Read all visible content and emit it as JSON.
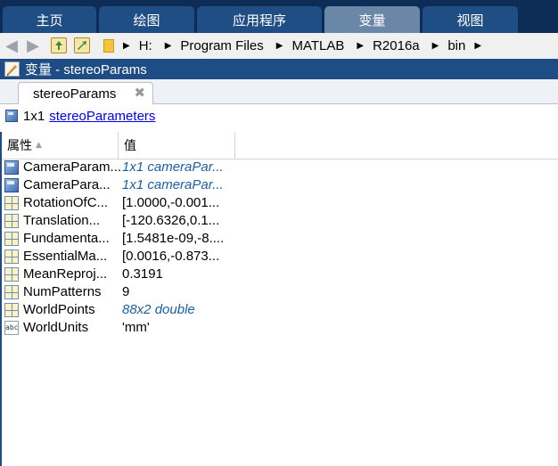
{
  "ribbon": {
    "tabs": [
      {
        "label": "主页",
        "active": false
      },
      {
        "label": "绘图",
        "active": false
      },
      {
        "label": "应用程序",
        "active": false
      },
      {
        "label": "变量",
        "active": true
      },
      {
        "label": "视图",
        "active": false
      }
    ]
  },
  "address": {
    "crumbs": [
      "H:",
      "Program Files",
      "MATLAB",
      "R2016a",
      "bin"
    ]
  },
  "variable_window": {
    "title": "变量 - stereoParams",
    "doc_tab": "stereoParams",
    "size_text": "1x1",
    "class_link": "stereoParameters"
  },
  "table": {
    "col_property": "属性",
    "col_value": "值",
    "rows": [
      {
        "icon": "object-icon",
        "name": "CameraParam...",
        "value": "1x1 cameraPar...",
        "italic": true
      },
      {
        "icon": "object-icon",
        "name": "CameraPara...",
        "value": "1x1 cameraPar...",
        "italic": true
      },
      {
        "icon": "matrix-icon",
        "name": "RotationOfC...",
        "value": "[1.0000,-0.001...",
        "italic": false
      },
      {
        "icon": "matrix-icon",
        "name": "Translation...",
        "value": "[-120.6326,0.1...",
        "italic": false
      },
      {
        "icon": "matrix-icon",
        "name": "Fundamenta...",
        "value": "[1.5481e-09,-8....",
        "italic": false
      },
      {
        "icon": "matrix-icon",
        "name": "EssentialMa...",
        "value": "[0.0016,-0.873...",
        "italic": false
      },
      {
        "icon": "matrix-icon",
        "name": "MeanReproj...",
        "value": "0.3191",
        "italic": false
      },
      {
        "icon": "matrix-icon",
        "name": "NumPatterns",
        "value": "9",
        "italic": false
      },
      {
        "icon": "matrix-icon",
        "name": "WorldPoints",
        "value": "88x2 double",
        "italic": true
      },
      {
        "icon": "string-icon",
        "name": "WorldUnits",
        "value": "'mm'",
        "italic": false
      }
    ]
  }
}
